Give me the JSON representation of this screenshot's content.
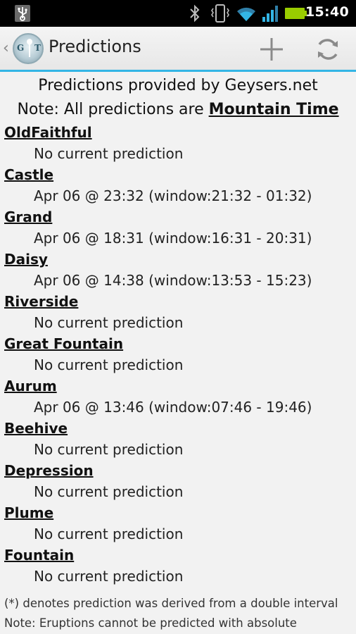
{
  "status_bar": {
    "time": "15:40",
    "icons": [
      "usb-icon",
      "bluetooth-icon",
      "vibrate-icon",
      "wifi-icon",
      "signal-icon",
      "battery-icon"
    ]
  },
  "action_bar": {
    "title": "Predictions",
    "logo_text": "G T",
    "actions": [
      "add-icon",
      "refresh-icon"
    ]
  },
  "header": {
    "line1": "Predictions provided by Geysers.net",
    "line2_prefix": "Note: All predictions are ",
    "timezone": "Mountain Time"
  },
  "geysers": [
    {
      "name": "OldFaithful",
      "prediction": "No current prediction"
    },
    {
      "name": "Castle",
      "prediction": "Apr 06 @ 23:32 (window:21:32 - 01:32)"
    },
    {
      "name": "Grand",
      "prediction": "Apr 06 @ 18:31 (window:16:31 - 20:31)"
    },
    {
      "name": "Daisy",
      "prediction": "Apr 06 @ 14:38 (window:13:53 - 15:23)"
    },
    {
      "name": "Riverside",
      "prediction": "No current prediction"
    },
    {
      "name": "Great Fountain",
      "prediction": "No current prediction"
    },
    {
      "name": "Aurum",
      "prediction": "Apr 06 @ 13:46 (window:07:46 - 19:46)"
    },
    {
      "name": "Beehive",
      "prediction": "No current prediction"
    },
    {
      "name": "Depression",
      "prediction": "No current prediction"
    },
    {
      "name": "Plume",
      "prediction": "No current prediction"
    },
    {
      "name": "Fountain",
      "prediction": "No current prediction"
    }
  ],
  "footer": {
    "line1": "(*) denotes prediction was derived from a double interval",
    "line2": "Note: Eruptions cannot be predicted with absolute"
  },
  "colors": {
    "accent": "#33b5e5",
    "battery": "#99cc00",
    "background": "#f2f2f2"
  }
}
